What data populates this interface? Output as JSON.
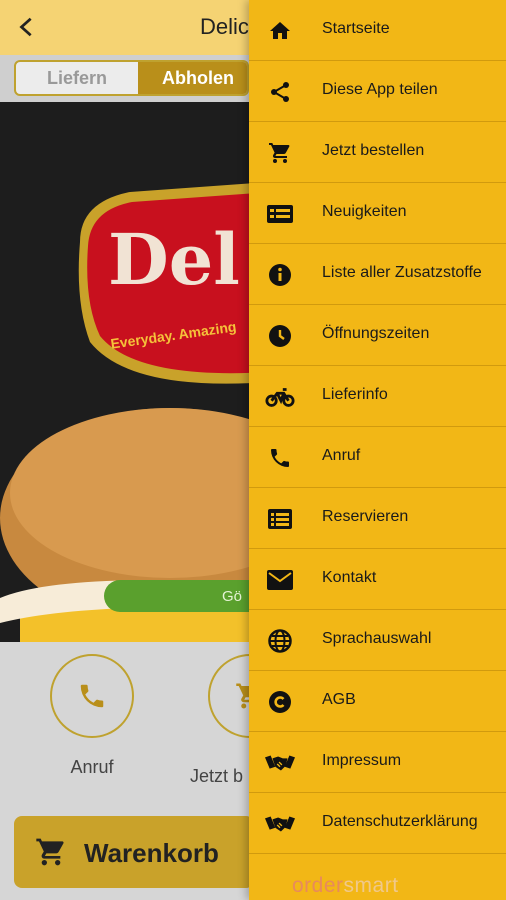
{
  "header": {
    "title": "Delic"
  },
  "tabs": {
    "liefern": "Liefern",
    "abholen": "Abholen"
  },
  "hero": {
    "logo_text": "Del",
    "tagline": "Everyday. Amazing",
    "status_text": "Gö"
  },
  "actions": {
    "call_label": "Anruf",
    "order_label": "Jetzt b"
  },
  "cart": {
    "label": "Warenkorb"
  },
  "menu": {
    "items": [
      {
        "label": "Startseite",
        "icon": "home-icon"
      },
      {
        "label": "Diese App teilen",
        "icon": "share-icon"
      },
      {
        "label": "Jetzt bestellen",
        "icon": "cart-icon"
      },
      {
        "label": "Neuigkeiten",
        "icon": "news-icon"
      },
      {
        "label": "Liste aller Zusatzstoffe",
        "icon": "info-icon"
      },
      {
        "label": "Öffnungszeiten",
        "icon": "clock-icon"
      },
      {
        "label": "Lieferinfo",
        "icon": "motorbike-icon"
      },
      {
        "label": "Anruf",
        "icon": "phone-icon"
      },
      {
        "label": "Reservieren",
        "icon": "list-icon"
      },
      {
        "label": "Kontakt",
        "icon": "mail-icon"
      },
      {
        "label": "Sprachauswahl",
        "icon": "globe-icon"
      },
      {
        "label": "AGB",
        "icon": "copyright-icon"
      },
      {
        "label": "Impressum",
        "icon": "handshake-icon"
      },
      {
        "label": "Datenschutzerklärung",
        "icon": "handshake-icon"
      }
    ],
    "brand_part1": "order",
    "brand_part2": "smart"
  },
  "colors": {
    "drawer": "#f2b716",
    "accent": "#bfa22f",
    "header": "#f5d373"
  }
}
